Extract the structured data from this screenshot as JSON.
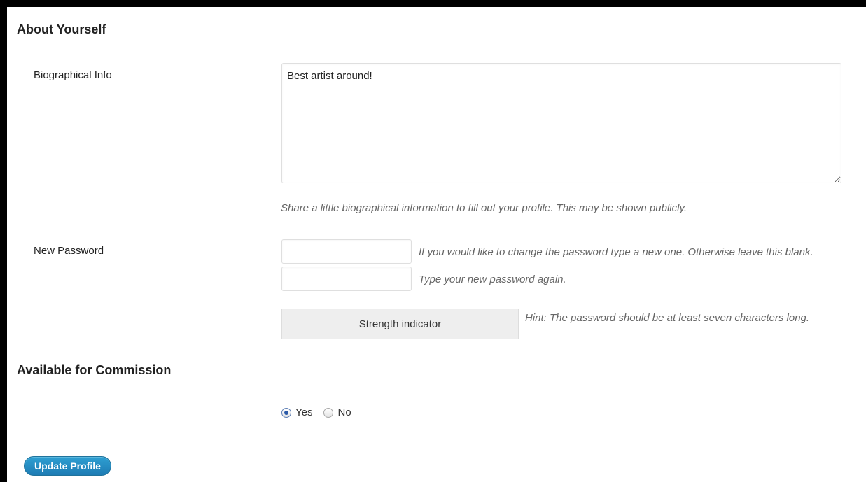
{
  "about": {
    "section_title": "About Yourself",
    "bio_label": "Biographical Info",
    "bio_value": "Best artist around!",
    "bio_description": "Share a little biographical information to fill out your profile. This may be shown publicly."
  },
  "password": {
    "label": "New Password",
    "field1_value": "",
    "field1_hint": "If you would like to change the password type a new one. Otherwise leave this blank.",
    "field2_value": "",
    "field2_hint": "Type your new password again.",
    "strength_label": "Strength indicator",
    "strength_hint": "Hint: The password should be at least seven characters long."
  },
  "commission": {
    "section_title": "Available for Commission",
    "options": [
      {
        "label": "Yes",
        "checked": true
      },
      {
        "label": "No",
        "checked": false
      }
    ]
  },
  "actions": {
    "update_label": "Update Profile"
  },
  "colors": {
    "page_border": "#000000",
    "primary_button": "#2588bd",
    "hint_text": "#666666"
  }
}
